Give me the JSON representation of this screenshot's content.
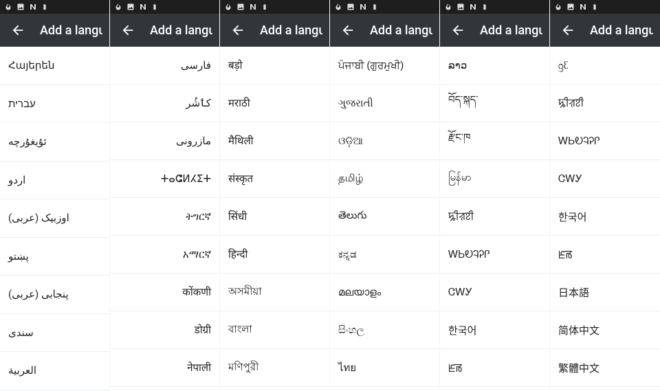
{
  "app_bar_title": "Add a langu",
  "status_icons": [
    "flame-icon",
    "image-icon",
    "n-icon",
    "battery-icon"
  ],
  "columns": [
    {
      "rtl": false,
      "items": [
        "Հայերեն",
        "עברית",
        "ئۇيغۇرچە",
        "اردو",
        "اوزبیک (عربی)",
        "پښتو",
        "پنجابی (عربی)",
        "سندی",
        "العربية"
      ]
    },
    {
      "rtl": true,
      "items": [
        "فارسی",
        "کٲشُر",
        "مازرونی",
        "ⵜⴰⵛⵍⵃⵉⵜ",
        "ትግርኛ",
        "አማርኛ",
        "कोंकणी",
        "डोग्री",
        "नेपाली"
      ]
    },
    {
      "rtl": false,
      "items": [
        "बड़ो",
        "मराठी",
        "मैथिली",
        "संस्कृत",
        "सिंधी",
        "हिन्दी",
        "অসমীয়া",
        "বাংলা",
        "মণিপুরী"
      ]
    },
    {
      "rtl": false,
      "items": [
        "ਪੰਜਾਬੀ (ਗੁਰਮੁਖੀ)",
        "ગુજરાતી",
        "ଓଡ଼ିଆ",
        "தமிழ்",
        "తెలుగు",
        "ಕನ್ನಡ",
        "മലയാളം",
        "සිංහල",
        "ไทย"
      ]
    },
    {
      "rtl": false,
      "items": [
        "ລາວ",
        "བོད་སྐད་",
        "རྫོང་ཁ",
        "မြန်မာ",
        "ꠍꠤꠟꠐꠤ",
        "ᎳᏏᎧᎸᎮᎵ",
        "ᏣᎳᎩ",
        "한국어",
        "ꡈꡏ"
      ]
    },
    {
      "rtl": false,
      "items": [
        "ᦋᦷ",
        "ꠍꠤꠟꠐꠤ",
        "ᎳᏏᎧᎸᎮᎵ",
        "ᏣᎳᎩ",
        "한국어",
        "ꡈꡏ",
        "日本語",
        "简体中文",
        "繁體中文"
      ]
    }
  ]
}
